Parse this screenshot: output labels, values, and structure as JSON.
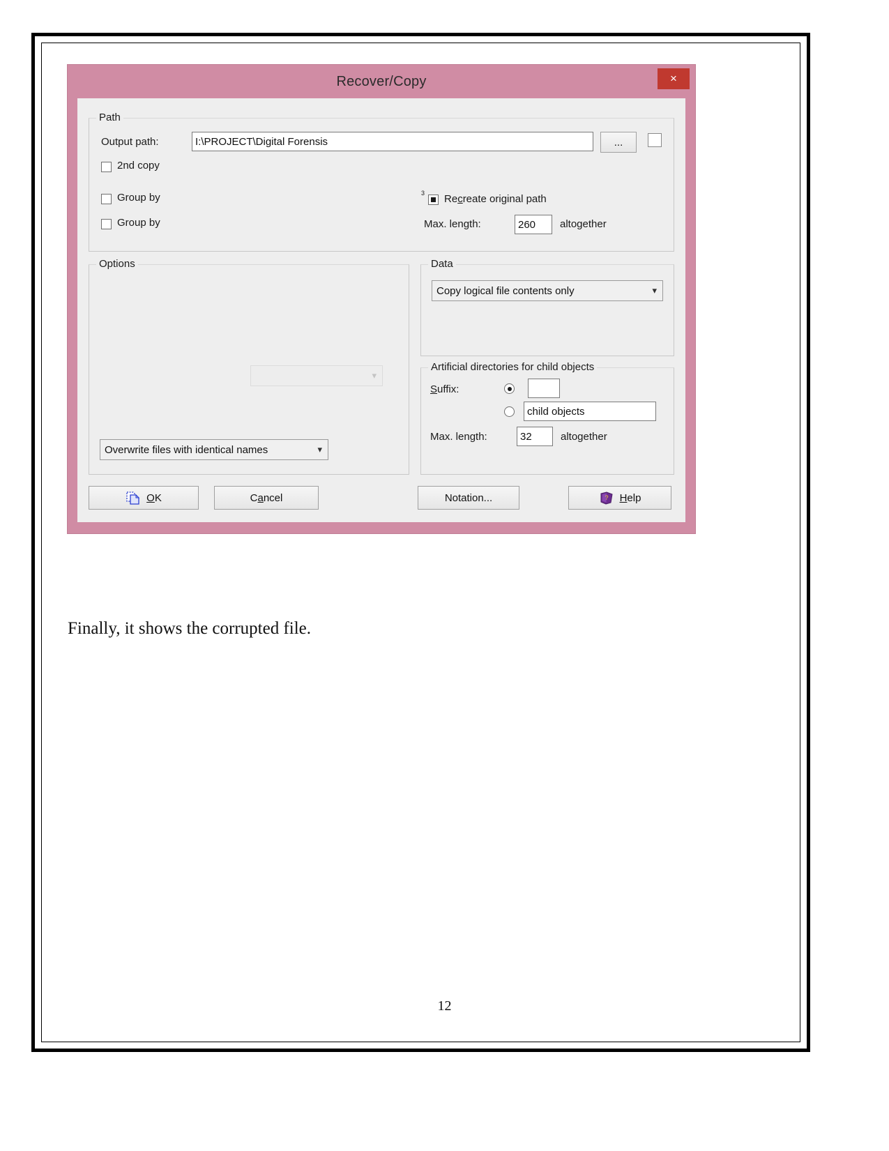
{
  "document": {
    "body_text": "Finally, it shows the corrupted file.",
    "page_number": "12"
  },
  "dialog": {
    "title": "Recover/Copy",
    "close_label": "×",
    "path_group": {
      "legend": "Path",
      "output_path_label": "Output path:",
      "output_path_value": "I:\\PROJECT\\Digital Forensis",
      "browse_button_label": "...",
      "second_copy_label": "2nd copy",
      "group_by_label_1": "Group by",
      "group_by_label_2": "Group by",
      "recreate_superscript": "3",
      "recreate_label": "Recreate original path",
      "max_length_label": "Max. length:",
      "max_length_value": "260",
      "altogether_label": "altogether"
    },
    "options_group": {
      "legend": "Options",
      "disabled_combo_value": "",
      "overwrite_combo_value": "Overwrite files with identical names"
    },
    "data_group": {
      "legend": "Data",
      "copy_mode_value": "Copy logical file contents only"
    },
    "artificial_group": {
      "legend": "Artificial directories for child objects",
      "suffix_label": "Suffix:",
      "suffix_value": "",
      "child_objects_value": "child objects",
      "max_length_label": "Max. length:",
      "max_length_value": "32",
      "altogether_label": "altogether"
    },
    "buttons": {
      "ok": "OK",
      "cancel": "Cancel",
      "notation": "Notation...",
      "help": "Help"
    }
  },
  "colors": {
    "titlebar": "#d08ca4",
    "close_button": "#c0392f",
    "dialog_body": "#eeeeee",
    "ok_icon": "#2b3fd0",
    "help_icon": "#6b2d8f"
  }
}
